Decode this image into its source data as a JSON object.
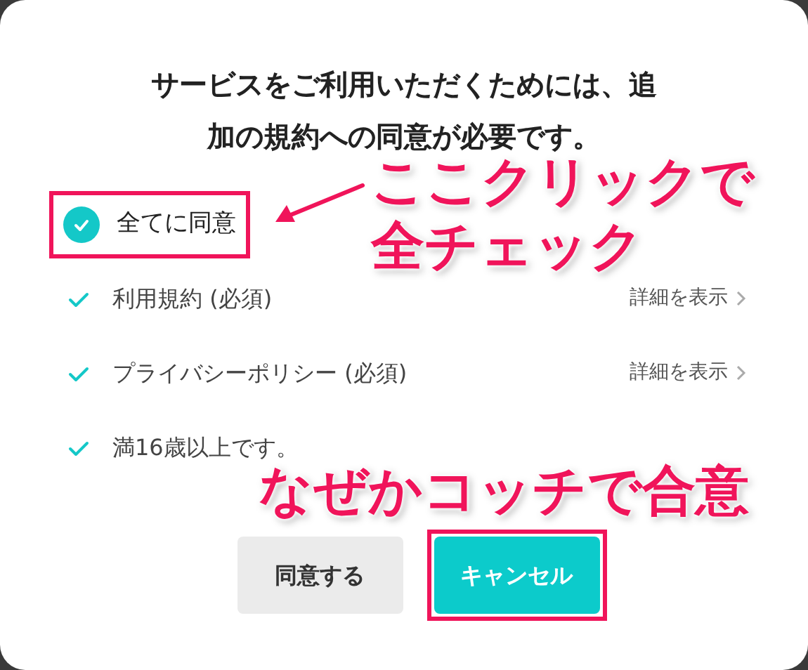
{
  "dialog": {
    "message": "サービスをご利用いただくためには、追加の規約への同意が必要です。",
    "agree_all": {
      "label": "全てに同意",
      "checked": true,
      "highlighted": true
    },
    "items": [
      {
        "label": "利用規約 (必須)",
        "checked": true,
        "link": "詳細を表示"
      },
      {
        "label": "プライバシーポリシー (必須)",
        "checked": true,
        "link": "詳細を表示"
      },
      {
        "label": "満16歳以上です。",
        "checked": true
      }
    ],
    "buttons": [
      {
        "label": "同意する",
        "kind": "secondary",
        "highlighted": false
      },
      {
        "label": "キャンセル",
        "kind": "primary",
        "highlighted": true
      }
    ]
  },
  "annotations": [
    {
      "kind": "callout_arrow",
      "lines": [
        "ここクリックで",
        "全チェック"
      ]
    },
    {
      "kind": "callout",
      "lines": [
        "なぜかコッチで合意"
      ]
    }
  ]
}
